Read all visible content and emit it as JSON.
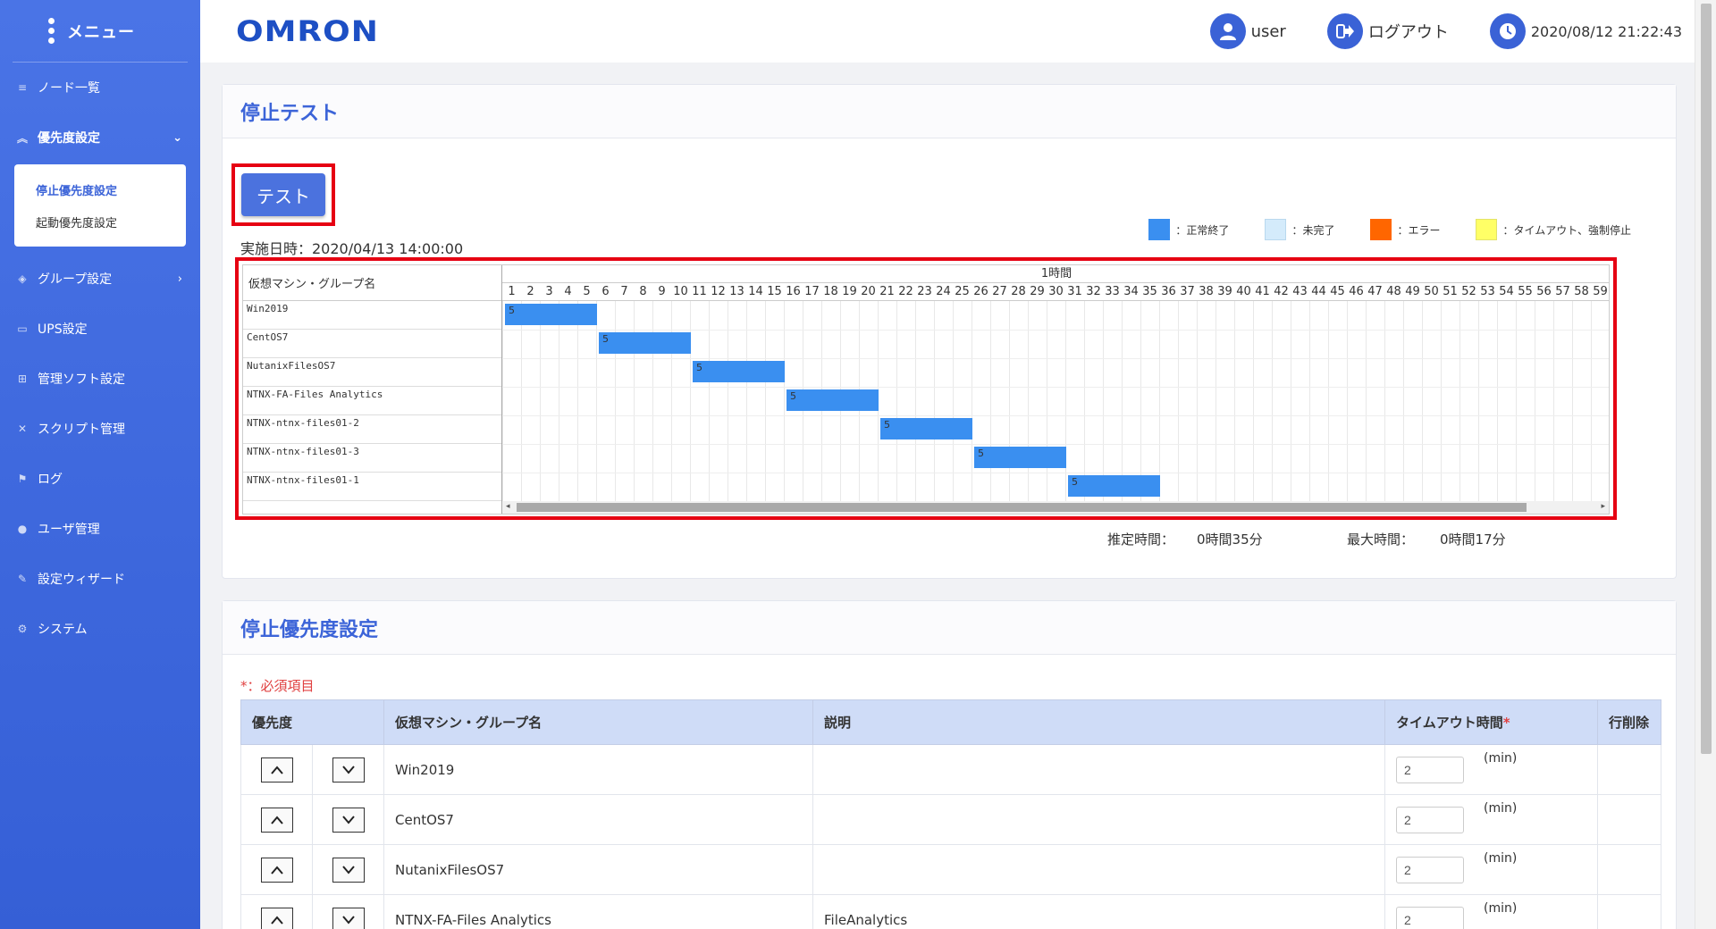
{
  "sidebar": {
    "menu_title": "メニュー",
    "items": [
      {
        "label": "ノード一覧"
      },
      {
        "label": "優先度設定"
      },
      {
        "label": "グループ設定"
      },
      {
        "label": "UPS設定"
      },
      {
        "label": "管理ソフト設定"
      },
      {
        "label": "スクリプト管理"
      },
      {
        "label": "ログ"
      },
      {
        "label": "ユーザ管理"
      },
      {
        "label": "設定ウィザード"
      },
      {
        "label": "システム"
      }
    ],
    "submenu": [
      {
        "label": "停止優先度設定"
      },
      {
        "label": "起動優先度設定"
      }
    ]
  },
  "header": {
    "logo": "OMRON",
    "user": "user",
    "logout": "ログアウト",
    "datetime": "2020/08/12 21:22:43"
  },
  "test_panel": {
    "title": "停止テスト",
    "test_button": "テスト",
    "exec_time": "実施日時：2020/04/13 14:00:00",
    "legend": [
      {
        "label": "：正常終了",
        "color": "#3a8ff0"
      },
      {
        "label": "：未完了",
        "color": "#d4ebfb"
      },
      {
        "label": "：エラー",
        "color": "#ff6600"
      },
      {
        "label": "：タイムアウト、強制停止",
        "color": "#ffff66"
      }
    ],
    "gantt": {
      "left_header": "仮想マシン・グループ名",
      "hour_label": "1時間",
      "minutes": [
        "1",
        "2",
        "3",
        "4",
        "5",
        "6",
        "7",
        "8",
        "9",
        "10",
        "11",
        "12",
        "13",
        "14",
        "15",
        "16",
        "17",
        "18",
        "19",
        "20",
        "21",
        "22",
        "23",
        "24",
        "25",
        "26",
        "27",
        "28",
        "29",
        "30",
        "31",
        "32",
        "33",
        "34",
        "35",
        "36",
        "37",
        "38",
        "39",
        "40",
        "41",
        "42",
        "43",
        "44",
        "45",
        "46",
        "47",
        "48",
        "49",
        "50",
        "51",
        "52",
        "53",
        "54",
        "55",
        "56",
        "57",
        "58",
        "59",
        "6"
      ],
      "rows": [
        {
          "name": "Win2019",
          "start": 1,
          "duration": 5,
          "label": "5"
        },
        {
          "name": "CentOS7",
          "start": 6,
          "duration": 5,
          "label": "5"
        },
        {
          "name": "NutanixFilesOS7",
          "start": 11,
          "duration": 5,
          "label": "5"
        },
        {
          "name": "NTNX-FA-Files Analytics",
          "start": 16,
          "duration": 5,
          "label": "5"
        },
        {
          "name": "NTNX-ntnx-files01-2",
          "start": 21,
          "duration": 5,
          "label": "5"
        },
        {
          "name": "NTNX-ntnx-files01-3",
          "start": 26,
          "duration": 5,
          "label": "5"
        },
        {
          "name": "NTNX-ntnx-files01-1",
          "start": 31,
          "duration": 5,
          "label": "5"
        }
      ]
    },
    "estimated_label": "推定時間：",
    "estimated_value": "0時間35分",
    "max_label": "最大時間：",
    "max_value": "0時間17分"
  },
  "priority_panel": {
    "title": "停止優先度設定",
    "required_note": "*：必須項目",
    "columns": {
      "priority": "優先度",
      "name": "仮想マシン・グループ名",
      "desc": "説明",
      "timeout": "タイムアウト時間",
      "delete": "行削除"
    },
    "unit": "(min)",
    "rows": [
      {
        "name": "Win2019",
        "desc": "",
        "timeout": "2"
      },
      {
        "name": "CentOS7",
        "desc": "",
        "timeout": "2"
      },
      {
        "name": "NutanixFilesOS7",
        "desc": "",
        "timeout": "2"
      },
      {
        "name": "NTNX-FA-Files Analytics",
        "desc": "FileAnalytics",
        "timeout": "2"
      }
    ]
  }
}
